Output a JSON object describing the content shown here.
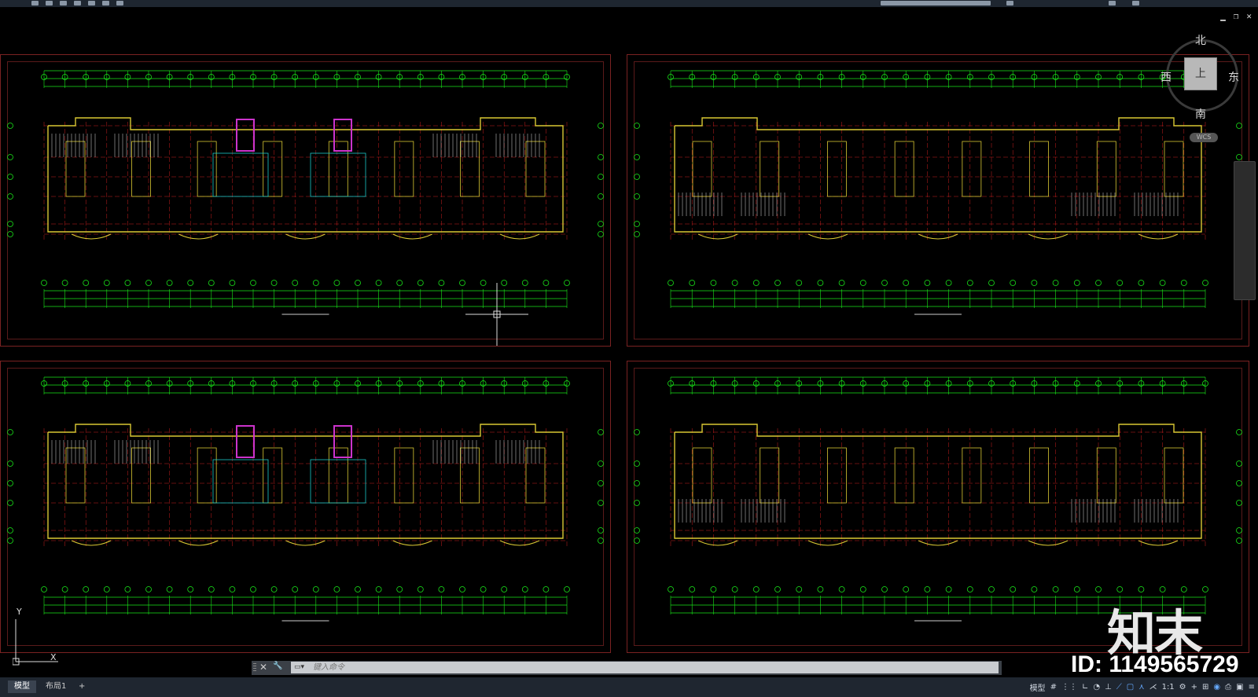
{
  "window": {
    "min_label": "▁",
    "restore_label": "❐",
    "close_label": "✕"
  },
  "viewcube": {
    "north": "北",
    "south": "南",
    "west": "西",
    "east": "东",
    "face": "上",
    "wcs": "WCS"
  },
  "command": {
    "placeholder": "键入命令",
    "close_label": "✕",
    "tool_label": "🔧"
  },
  "tabs": [
    {
      "label": "模型"
    },
    {
      "label": "布局1"
    },
    {
      "label": "+"
    }
  ],
  "status": {
    "model_label": "模型",
    "scale_label": "1:1"
  },
  "ucs": {
    "x": "X",
    "y": "Y"
  },
  "watermark": {
    "brand": "知末",
    "id": "ID: 1149565729"
  },
  "colors": {
    "frame": "#7a2222",
    "grid_green": "#19e619",
    "wall_yellow": "#d9c833",
    "stair_magenta": "#cc33cc",
    "axis_red": "#c81e1e"
  }
}
